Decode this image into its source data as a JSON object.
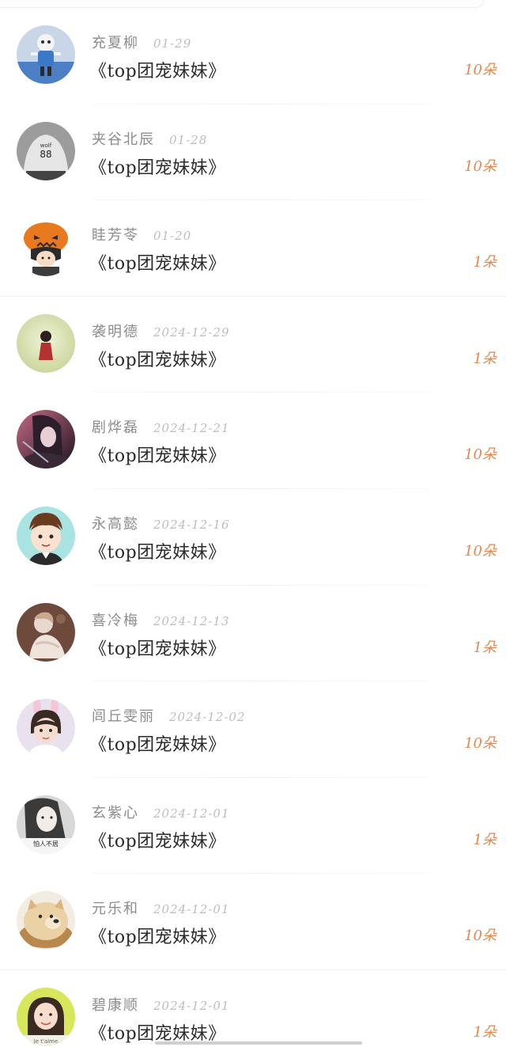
{
  "records": [
    {
      "name": "充夏柳",
      "date": "01-29",
      "title": "《top团宠妹妹》",
      "count": "10朵",
      "avatar_icon": "cartoon-skeleton-avatar",
      "avatar_colors": [
        "#4d7fc6",
        "#c9d6e8"
      ]
    },
    {
      "name": "夹谷北辰",
      "date": "01-28",
      "title": "《top团宠妹妹》",
      "count": "10朵",
      "avatar_icon": "wolf-88-shirt-avatar",
      "avatar_colors": [
        "#9c9c9c",
        "#e6e6e6"
      ],
      "avatar_text": [
        "wolf",
        "88"
      ]
    },
    {
      "name": "眭芳苓",
      "date": "01-20",
      "title": "《top团宠妹妹》",
      "count": "1朵",
      "avatar_icon": "pumpkin-head-boy-avatar",
      "avatar_colors": [
        "#e8791f",
        "#2b2b2b"
      ]
    },
    {
      "name": "袭明德",
      "date": "2024-12-29",
      "title": "《top团宠妹妹》",
      "count": "1朵",
      "avatar_icon": "girl-red-dress-avatar",
      "avatar_colors": [
        "#dfe6b9",
        "#b3312f"
      ]
    },
    {
      "name": "剧烨磊",
      "date": "2024-12-21",
      "title": "《top团宠妹妹》",
      "count": "10朵",
      "avatar_icon": "anime-dark-girl-avatar",
      "avatar_colors": [
        "#3c2a3c",
        "#c46a84"
      ]
    },
    {
      "name": "永高懿",
      "date": "2024-12-16",
      "title": "《top团宠妹妹》",
      "count": "10朵",
      "avatar_icon": "cartoon-boy-avatar",
      "avatar_colors": [
        "#a9e4e3",
        "#6b3b20"
      ]
    },
    {
      "name": "喜冷梅",
      "date": "2024-12-13",
      "title": "《top团宠妹妹》",
      "count": "1朵",
      "avatar_icon": "vintage-doll-avatar",
      "avatar_colors": [
        "#6e4a3d",
        "#e7d7cc"
      ]
    },
    {
      "name": "闾丘雯丽",
      "date": "2024-12-02",
      "title": "《top团宠妹妹》",
      "count": "10朵",
      "avatar_icon": "bunny-ears-child-avatar",
      "avatar_colors": [
        "#e9e2ee",
        "#3a2a24"
      ]
    },
    {
      "name": "玄紫心",
      "date": "2024-12-01",
      "title": "《top团宠妹妹》",
      "count": "1朵",
      "avatar_icon": "girl-portrait-avatar",
      "avatar_colors": [
        "#d8d8d8",
        "#3a3a3a"
      ],
      "avatar_text": [
        "怕人不居"
      ]
    },
    {
      "name": "元乐和",
      "date": "2024-12-01",
      "title": "《top团宠妹妹》",
      "count": "10朵",
      "avatar_icon": "doge-bread-avatar",
      "avatar_colors": [
        "#ead2a6",
        "#b9884e"
      ]
    },
    {
      "name": "碧康顺",
      "date": "2024-12-01",
      "title": "《top团宠妹妹》",
      "count": "1朵",
      "avatar_icon": "smiling-girl-avatar",
      "avatar_colors": [
        "#d7e65a",
        "#3b2a22"
      ],
      "avatar_text": [
        "Je t'aime"
      ]
    }
  ]
}
